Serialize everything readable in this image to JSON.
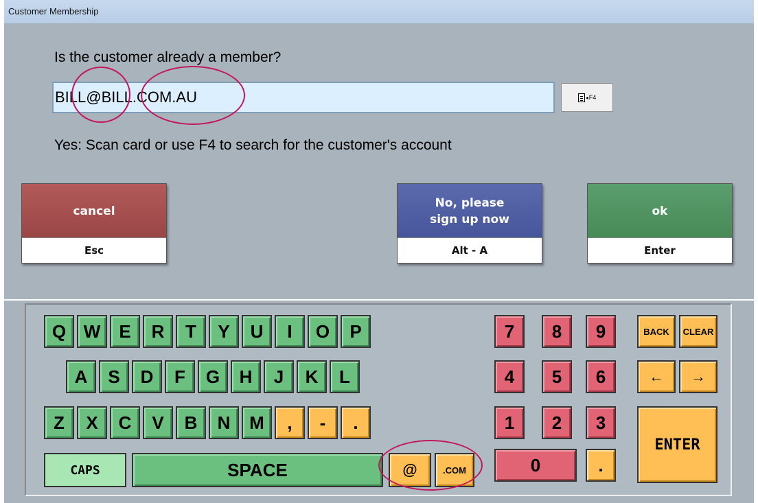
{
  "window": {
    "title": "Customer Membership"
  },
  "form": {
    "question": "Is the customer already a member?",
    "email_value": "BILL@BILL.COM.AU",
    "f4_button_label": "F4",
    "hint": "Yes: Scan card or use F4 to search for the customer's account"
  },
  "actions": {
    "cancel": {
      "label": "cancel",
      "shortcut": "Esc"
    },
    "signup": {
      "label": "No, please sign up now",
      "shortcut": "Alt - A"
    },
    "ok": {
      "label": "ok",
      "shortcut": "Enter"
    }
  },
  "keyboard": {
    "row1": [
      "Q",
      "W",
      "E",
      "R",
      "T",
      "Y",
      "U",
      "I",
      "O",
      "P"
    ],
    "row2": [
      "A",
      "S",
      "D",
      "F",
      "G",
      "H",
      "J",
      "K",
      "L"
    ],
    "row3": [
      "Z",
      "X",
      "C",
      "V",
      "B",
      "N",
      "M"
    ],
    "punct": [
      ",",
      "-",
      "."
    ],
    "caps": "CAPS",
    "space": "SPACE",
    "at": "@",
    "dotcom": ".COM",
    "numpad": [
      "7",
      "8",
      "9",
      "4",
      "5",
      "6",
      "1",
      "2",
      "3",
      "0",
      "."
    ],
    "back": "BACK",
    "clear": "CLEAR",
    "left_arrow": "←",
    "right_arrow": "→",
    "enter": "ENTER"
  },
  "colors": {
    "window_bg": "#a9b3bc",
    "letter_key": "#6cc07f",
    "number_key": "#e16475",
    "special_key": "#ffbf55",
    "annotation": "#c2185b"
  }
}
